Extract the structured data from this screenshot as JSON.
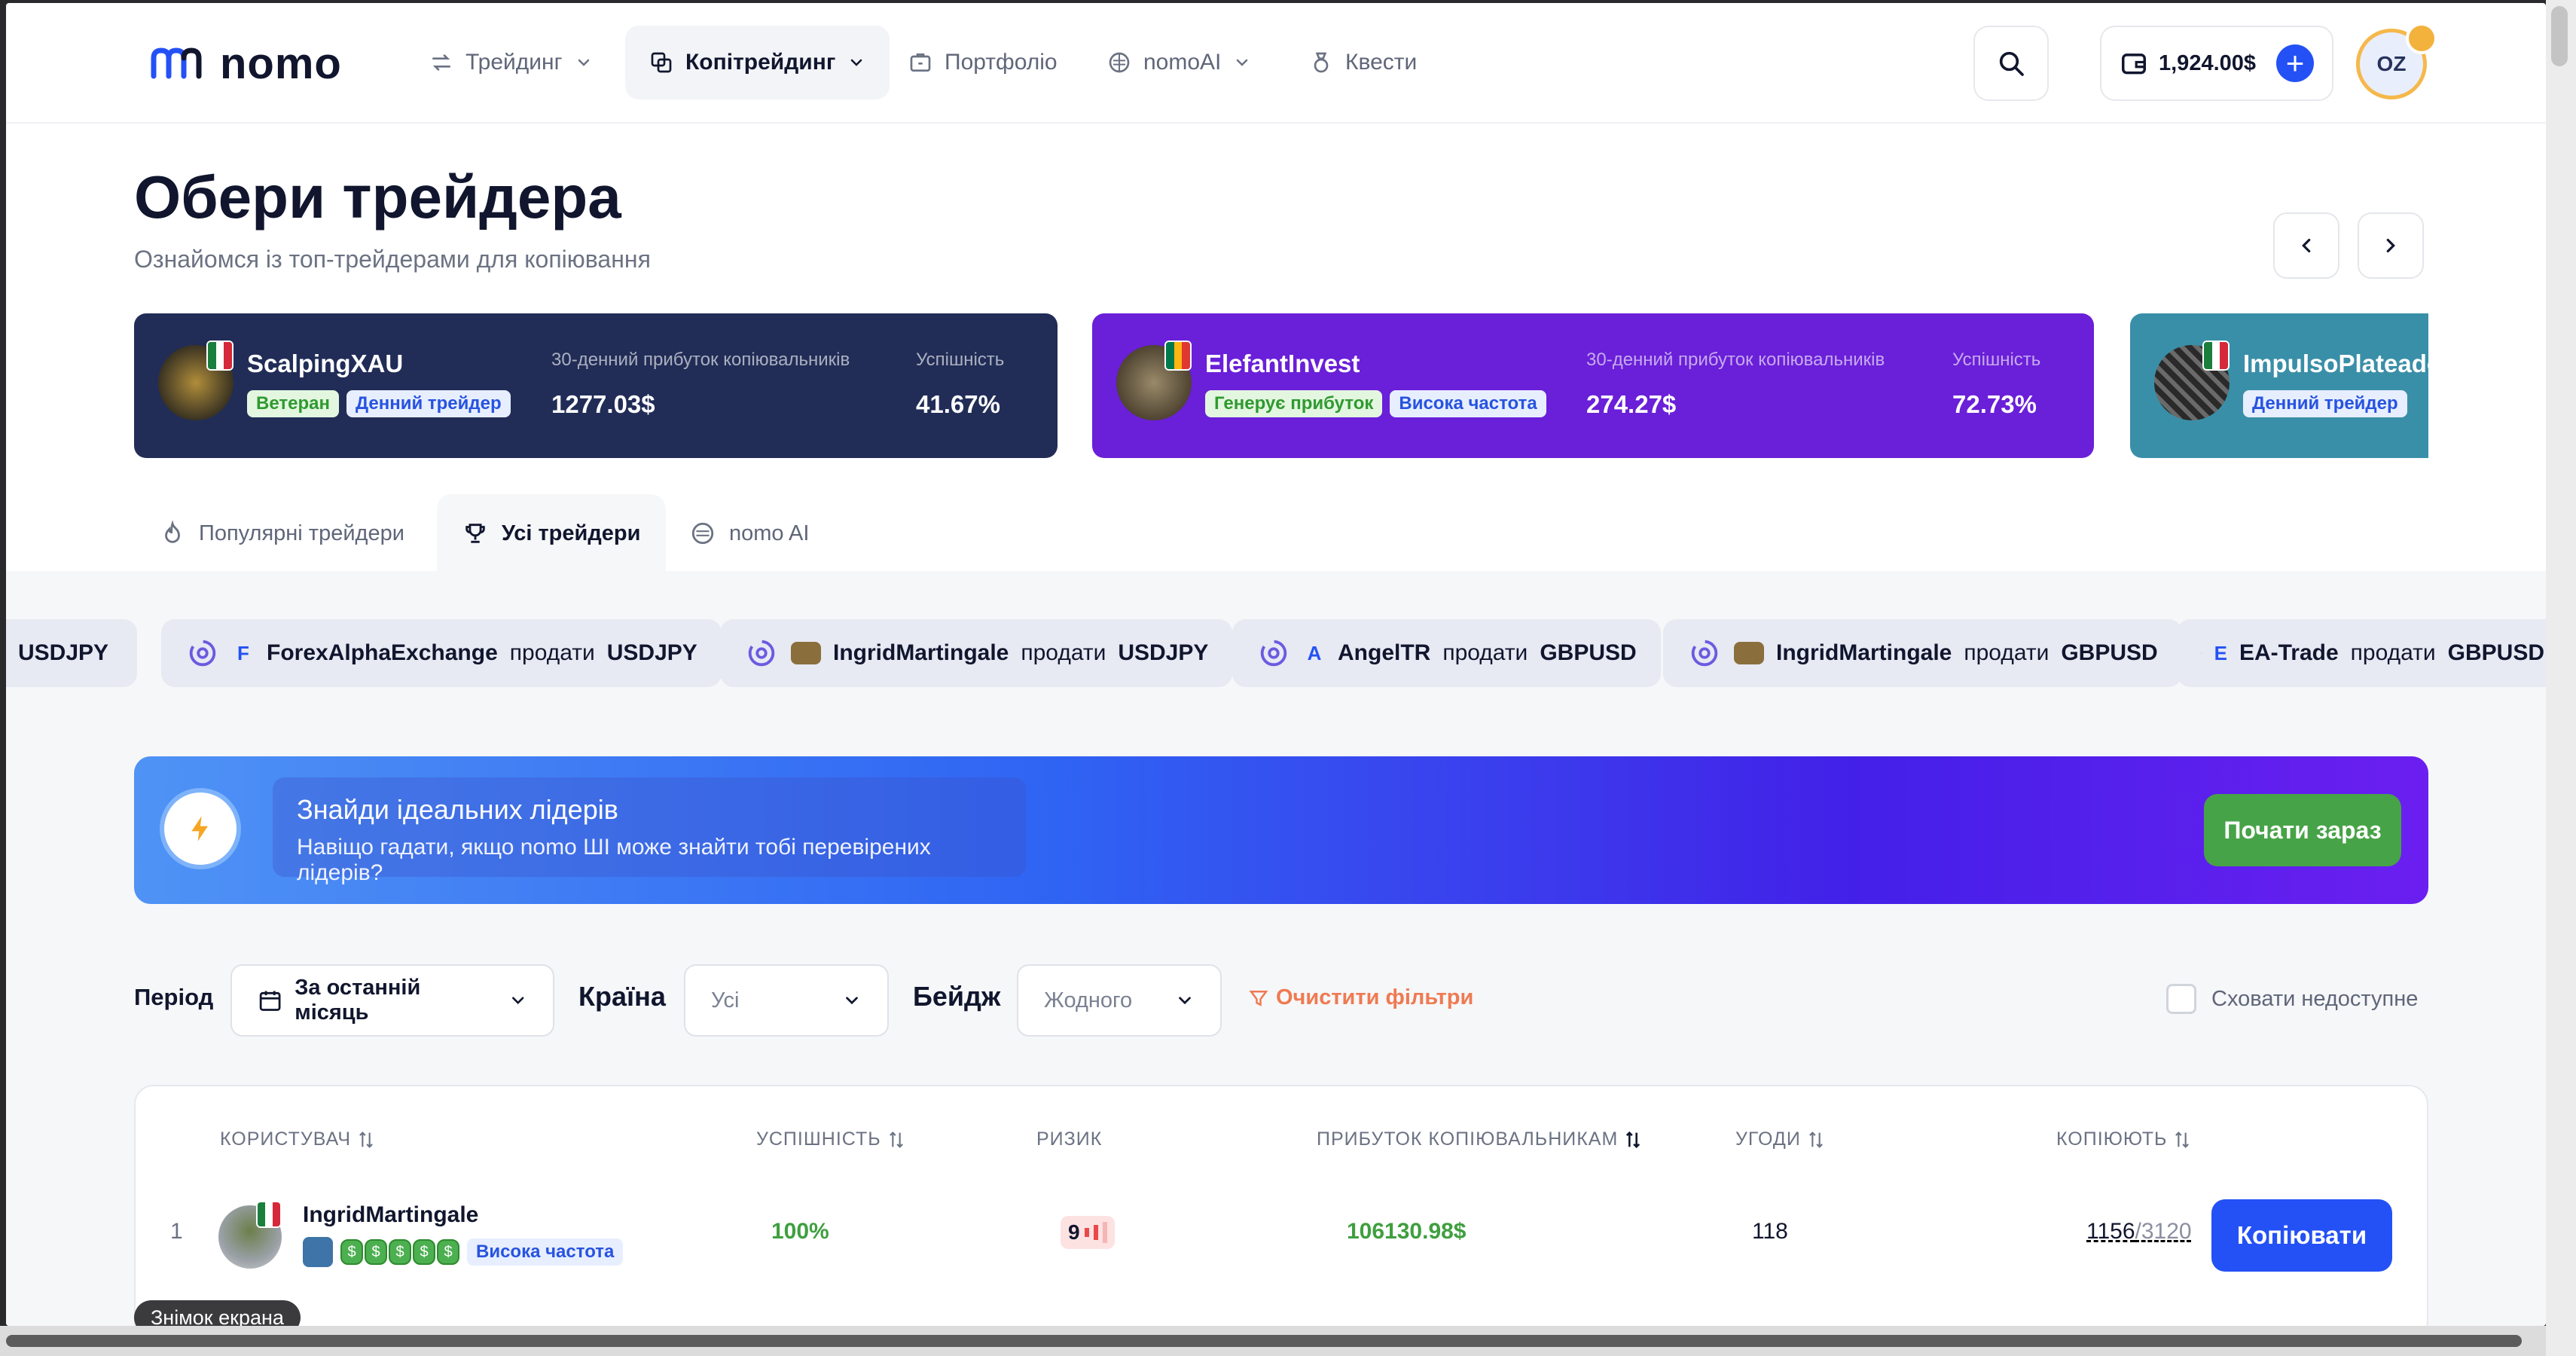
{
  "colors": {
    "accent": "#2451f5",
    "success": "#47a347",
    "danger": "#e94949",
    "warning": "#ef7a52",
    "dark_card": "#212d57",
    "purple_card": "#6a1fd8",
    "teal_card": "#3a8fa8"
  },
  "header": {
    "logo": "nomo",
    "nav": [
      {
        "label": "Трейдинг",
        "icon": "swap-icon"
      },
      {
        "label": "Копітрейдинг",
        "icon": "copy-icon"
      },
      {
        "label": "Портфоліо",
        "icon": "briefcase-icon"
      },
      {
        "label": "nomoAI",
        "icon": "ai-icon"
      },
      {
        "label": "Квести",
        "icon": "quest-icon"
      }
    ],
    "balance": "1,924.00$",
    "avatar_initials": "OZ"
  },
  "hero": {
    "title": "Обери трейдера",
    "subtitle": "Ознайомся із топ-трейдерами для копіювання"
  },
  "carousel": {
    "profit_label": "30-денний прибуток копіювальників",
    "success_label": "Успішність",
    "cards": [
      {
        "name": "ScalpingXAU",
        "badges": [
          "Ветеран",
          "Денний трейдер"
        ],
        "profit": "1277.03$",
        "success": "41.67%",
        "flag": "mexico"
      },
      {
        "name": "ElefantInvest",
        "badges": [
          "Генерує прибуток",
          "Висока частота"
        ],
        "profit": "274.27$",
        "success": "72.73%",
        "flag": "south-africa"
      },
      {
        "name": "ImpulsoPlateado",
        "badges": [
          "Денний трейдер"
        ],
        "flag": "mexico"
      }
    ]
  },
  "tabs": [
    "Популярні трейдери",
    "Усі трейдери",
    "nomo AI"
  ],
  "ticker": [
    {
      "tail": "USDJPY"
    },
    {
      "letter": "F",
      "user": "ForexAlphaExchange",
      "action": "продати",
      "pair": "USDJPY"
    },
    {
      "user": "IngridMartingale",
      "action": "продати",
      "pair": "USDJPY"
    },
    {
      "letter": "A",
      "user": "AngelTR",
      "action": "продати",
      "pair": "GBPUSD"
    },
    {
      "user": "IngridMartingale",
      "action": "продати",
      "pair": "GBPUSD"
    },
    {
      "letter": "E",
      "user": "EA-Trade",
      "action": "продати",
      "pair": "GBPUSD"
    }
  ],
  "banner": {
    "title": "Знайди ідеальних лідерів",
    "text": "Навіщо гадати, якщо nomo ШІ може знайти тобі перевірених лідерів?",
    "button": "Почати зараз"
  },
  "filters": {
    "period_label": "Період",
    "period_value": "За останній місяць",
    "country_label": "Країна",
    "country_value": "Усі",
    "badge_label": "Бейдж",
    "badge_value": "Жодного",
    "clear": "Очистити фільтри",
    "hide_unavailable": "Сховати недоступне"
  },
  "table": {
    "columns": [
      "КОРИСТУВАЧ",
      "УСПІШНІСТЬ",
      "РИЗИК",
      "ПРИБУТОК КОПІЮВАЛЬНИКАМ",
      "УГОДИ",
      "КОПІЮЮТЬ"
    ],
    "rows": [
      {
        "rank": "1",
        "user": "IngridMartingale",
        "badge": "Висока частота",
        "success": "100%",
        "risk": "9",
        "profit": "106130.98$",
        "trades": "118",
        "copiers": "1156",
        "copiers_max": "/3120",
        "button": "Копіювати"
      }
    ]
  },
  "tooltip": "Знімок екрана"
}
